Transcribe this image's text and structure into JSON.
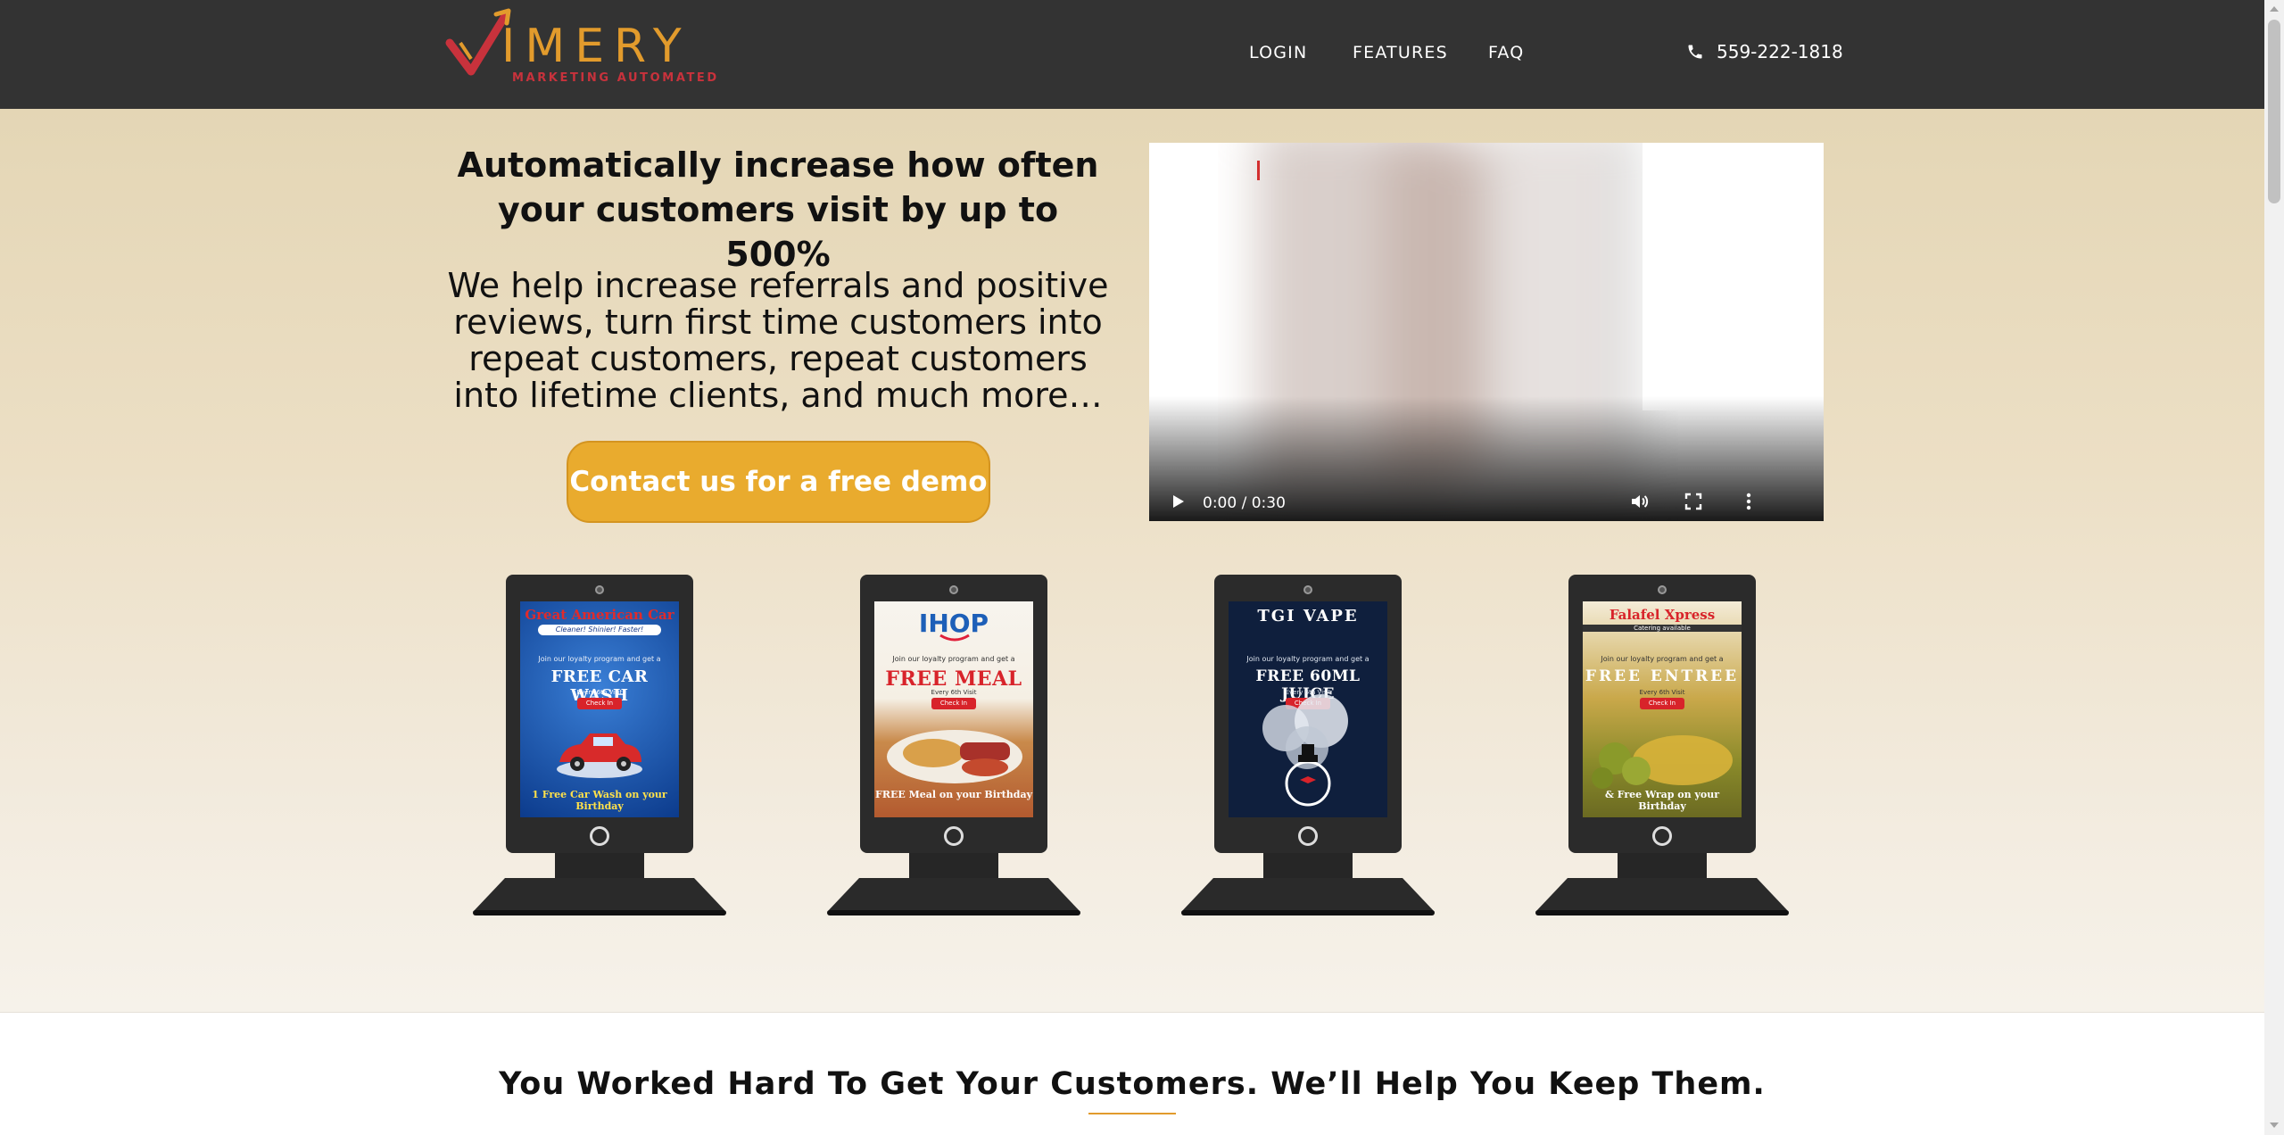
{
  "brand": {
    "name": "IMERY",
    "tagline": "MARKETING AUTOMATED",
    "colors": {
      "accent": "#e29b2c",
      "check": "#c8323c",
      "header": "#333333"
    }
  },
  "nav": {
    "items": [
      {
        "label": "LOGIN"
      },
      {
        "label": "FEATURES"
      },
      {
        "label": "FAQ"
      }
    ],
    "phone": {
      "icon": "phone-icon",
      "number": "559-222-1818"
    }
  },
  "hero": {
    "heading": "Automatically increase how often your customers visit by up to 500%",
    "subheading": "We help increase referrals and positive reviews, turn first time customers into repeat customers, repeat customers into lifetime clients, and much more…",
    "cta_label": "Contact us for a free demo",
    "cta_color": "#e9ab2e"
  },
  "video": {
    "time": "0:00 / 0:30",
    "buffered_fraction": 0.14,
    "controls": [
      "play-icon",
      "volume-icon",
      "fullscreen-icon",
      "more-options-icon"
    ]
  },
  "kiosks": [
    {
      "title": "Great American Car Wash",
      "subtitle": "Cleaner! Shinier! Faster!",
      "line": "Join our loyalty program and get a",
      "offer": "FREE CAR WASH",
      "visit": "Every 6th Visit",
      "check_in": "Check In",
      "birthday": "1 Free Car Wash on your Birthday"
    },
    {
      "title": "IHOP",
      "line": "Join our loyalty program and get a",
      "offer": "FREE MEAL",
      "visit": "Every 6th Visit",
      "check_in": "Check In",
      "birthday": "FREE Meal on your Birthday"
    },
    {
      "title": "TGI VAPE",
      "line": "Join our loyalty program and get a",
      "offer": "FREE 60ML JUICE",
      "visit": "Every 6th Visit",
      "check_in": "Check In"
    },
    {
      "title": "Falafel Xpress",
      "subtitle": "Catering available",
      "line": "Join our loyalty program and get a",
      "offer": "FREE ENTREE",
      "visit": "Every 6th Visit",
      "check_in": "Check In",
      "birthday": "& Free Wrap on your Birthday"
    }
  ],
  "section": {
    "title": "You Worked Hard To Get Your Customers. We’ll Help You Keep Them."
  }
}
